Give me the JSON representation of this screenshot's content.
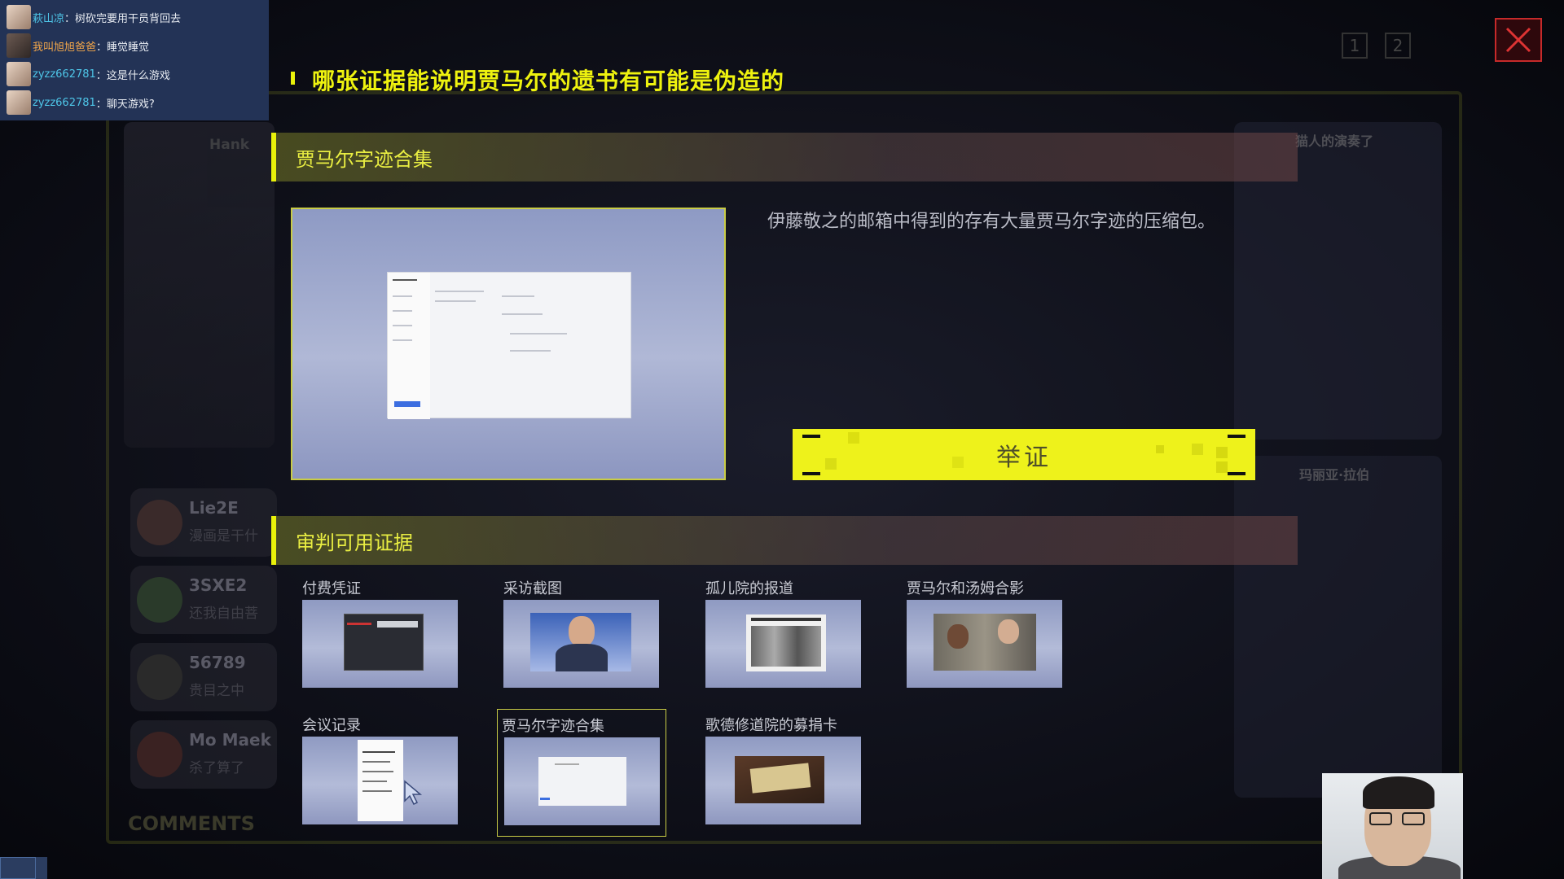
{
  "chat": [
    {
      "name": "萩山凉",
      "message": "树砍完要用干员背回去",
      "name_color": "#4ec6e8"
    },
    {
      "name": "我叫旭旭爸爸",
      "message": "睡觉睡觉",
      "name_color": "#f2a64a"
    },
    {
      "name": "zyzz662781",
      "message": "这是什么游戏",
      "name_color": "#4ec6e8"
    },
    {
      "name": "zyzz662781",
      "message": "聊天游戏?",
      "name_color": "#4ec6e8"
    }
  ],
  "question": "哪张证据能说明贾马尔的遗书有可能是伪造的",
  "selected_section": {
    "title": "贾马尔字迹合集",
    "description": "伊藤敬之的邮箱中得到的存有大量贾马尔字迹的压缩包。"
  },
  "present_button": "举证",
  "evidence_section": {
    "title": "审判可用证据",
    "items": [
      {
        "label": "付费凭证",
        "icon": "payment-screenshot"
      },
      {
        "label": "采访截图",
        "icon": "interview-portrait"
      },
      {
        "label": "孤儿院的报道",
        "icon": "newspaper-photo"
      },
      {
        "label": "贾马尔和汤姆合影",
        "icon": "group-photo"
      },
      {
        "label": "会议记录",
        "icon": "document-page"
      },
      {
        "label": "贾马尔字迹合集",
        "icon": "email-window",
        "selected": true
      },
      {
        "label": "歌德修道院的募捐卡",
        "icon": "donation-card"
      }
    ]
  },
  "background": {
    "left_name": "Hank",
    "comments": [
      {
        "name": "Lie2E",
        "text": "漫画是干什"
      },
      {
        "name": "3SXE2",
        "text": "还我自由菩"
      },
      {
        "name": "56789",
        "text": "贵目之中"
      },
      {
        "name": "Mo Maek",
        "text": "杀了算了"
      }
    ],
    "comments_label": "COMMENTS",
    "right_top_text": "猫人的演奏了",
    "right_mid_text": "玛丽亚·拉伯",
    "page_numbers": [
      "1",
      "2"
    ]
  },
  "colors": {
    "accent_yellow": "#e9f10a",
    "close_red": "#c62a2a",
    "chat_bg": "#233356"
  }
}
